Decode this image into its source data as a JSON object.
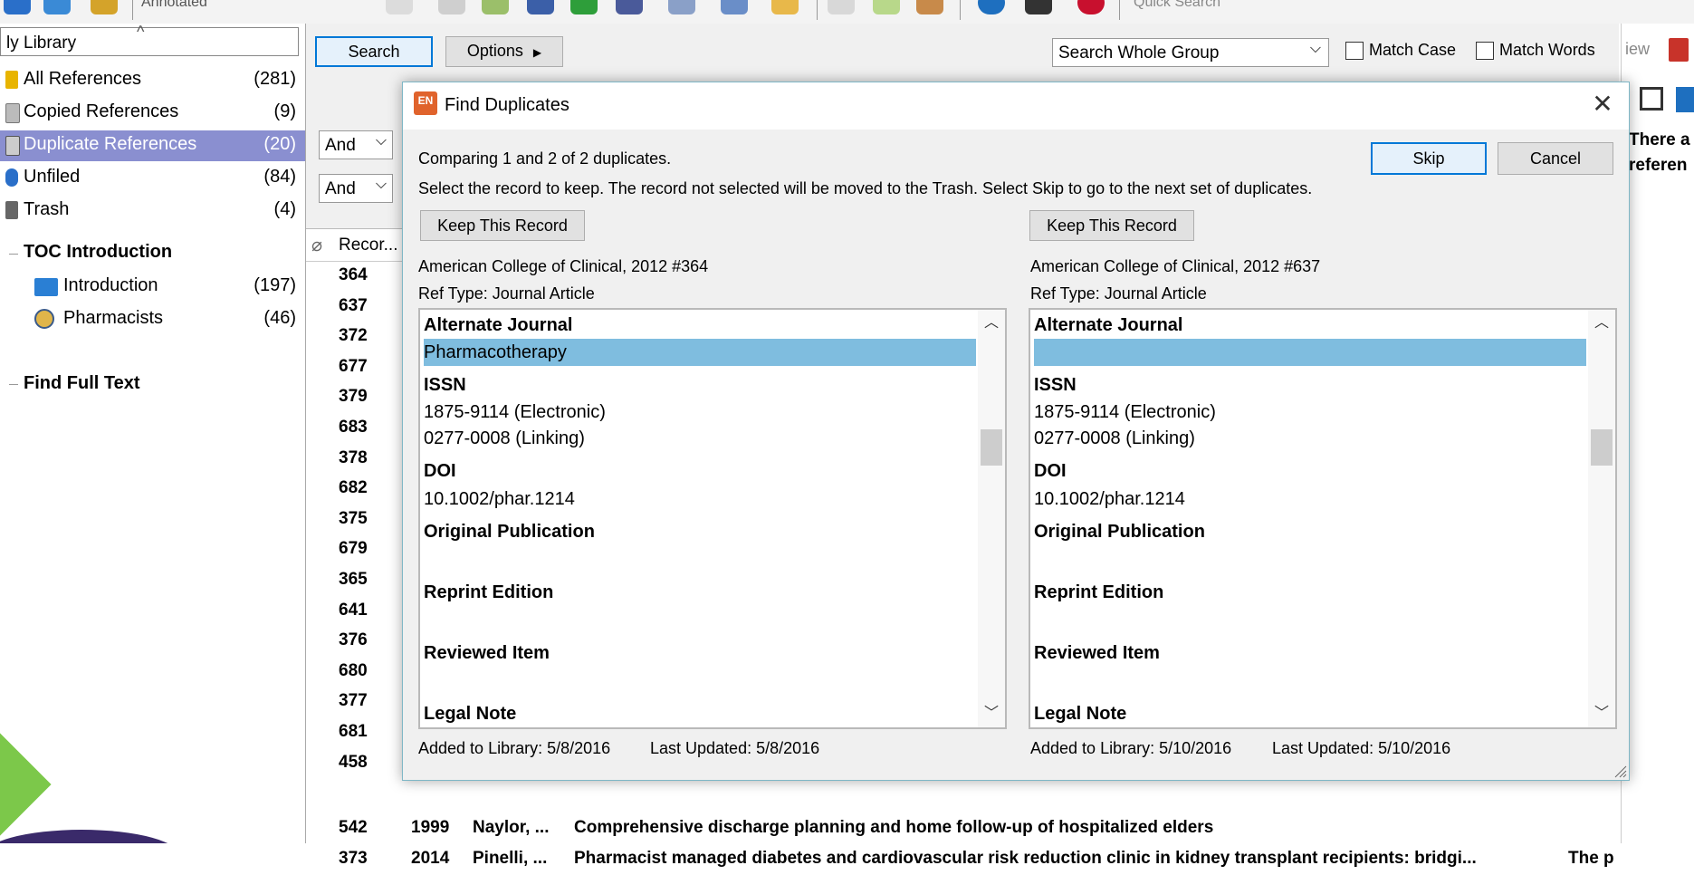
{
  "toolbar": {
    "annotated_label": "Annotated",
    "quick_search_placeholder": "Quick Search"
  },
  "library": {
    "header": "ly Library",
    "groups": [
      {
        "label": "All References",
        "count": "(281)",
        "icon": "all-references-icon",
        "color": "#e8b400"
      },
      {
        "label": "Copied References",
        "count": "(9)",
        "icon": "copied-references-icon",
        "color": "#777777"
      },
      {
        "label": "Duplicate References",
        "count": "(20)",
        "icon": "duplicate-references-icon",
        "color": "#555555"
      },
      {
        "label": "Unfiled",
        "count": "(84)",
        "icon": "unfiled-icon",
        "color": "#2a6fc9"
      },
      {
        "label": "Trash",
        "count": "(4)",
        "icon": "trash-icon",
        "color": "#555555"
      }
    ],
    "group_sets": [
      {
        "title": "TOC Introduction",
        "items": [
          {
            "label": "Introduction",
            "count": "(197)",
            "icon": "folder-icon"
          },
          {
            "label": "Pharmacists",
            "count": "(46)",
            "icon": "smart-group-icon"
          }
        ]
      },
      {
        "title": "Find Full Text",
        "items": []
      }
    ]
  },
  "search": {
    "search_button": "Search",
    "options_button": "Options",
    "scope": "Search Whole Group",
    "match_case": "Match Case",
    "match_words": "Match Words",
    "bool_1": "And",
    "bool_2": "And"
  },
  "reference_list": {
    "record_header": "Recor...",
    "record_numbers": [
      "364",
      "637",
      "372",
      "677",
      "379",
      "683",
      "378",
      "682",
      "375",
      "679",
      "365",
      "641",
      "376",
      "680",
      "377",
      "681",
      "458"
    ],
    "rows": [
      {
        "num": "542",
        "year": "1999",
        "author": "Naylor, ...",
        "title": "Comprehensive discharge planning and home follow-up of hospitalized elders",
        "extra": ""
      },
      {
        "num": "373",
        "year": "2014",
        "author": "Pinelli, ...",
        "title": "Pharmacist managed diabetes and cardiovascular risk reduction clinic in kidney transplant recipients: bridgi...",
        "extra": "The p"
      }
    ]
  },
  "right_pane": {
    "tab_label": "iew",
    "text_line1": "There a",
    "text_line2": "referen"
  },
  "dialog": {
    "title": "Find Duplicates",
    "app_badge": "EN",
    "comparing_text": "Comparing 1 and 2 of 2 duplicates.",
    "instruction_text": "Select the record to keep. The record not selected will be moved to the Trash. Select Skip to go to the next set of duplicates.",
    "skip_button": "Skip",
    "cancel_button": "Cancel",
    "left": {
      "keep_button": "Keep This Record",
      "citation": "American College of Clinical, 2012 #364",
      "ref_type": "Ref Type: Journal Article",
      "alternate_journal_label": "Alternate Journal",
      "alternate_journal_value": "Pharmacotherapy",
      "issn_label": "ISSN",
      "issn_line1": "1875-9114 (Electronic)",
      "issn_line2": "0277-0008 (Linking)",
      "doi_label": "DOI",
      "doi_value": "10.1002/phar.1214",
      "original_publication_label": "Original Publication",
      "reprint_edition_label": "Reprint Edition",
      "reviewed_item_label": "Reviewed Item",
      "legal_note_label": "Legal Note",
      "added": "Added to Library: 5/8/2016",
      "updated": "Last Updated: 5/8/2016"
    },
    "right": {
      "keep_button": "Keep This Record",
      "citation": "American College of Clinical, 2012 #637",
      "ref_type": "Ref Type: Journal Article",
      "alternate_journal_label": "Alternate Journal",
      "alternate_journal_value": "",
      "issn_label": "ISSN",
      "issn_line1": "1875-9114 (Electronic)",
      "issn_line2": "0277-0008 (Linking)",
      "doi_label": "DOI",
      "doi_value": "10.1002/phar.1214",
      "original_publication_label": "Original Publication",
      "reprint_edition_label": "Reprint Edition",
      "reviewed_item_label": "Reviewed Item",
      "legal_note_label": "Legal Note",
      "added": "Added to Library: 5/10/2016",
      "updated": "Last Updated: 5/10/2016"
    }
  },
  "colors": {
    "selection": "#8a8fd0",
    "field_highlight": "#7fbddf",
    "dialog_border": "#7fb7c6",
    "accent": "#0078d7"
  }
}
